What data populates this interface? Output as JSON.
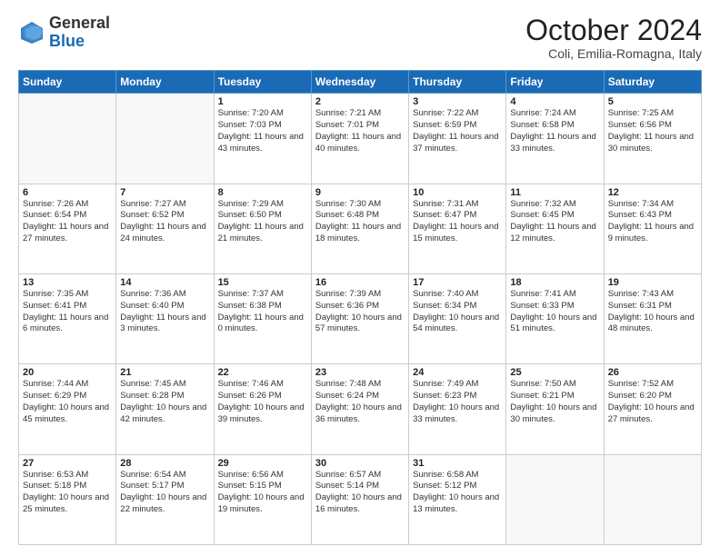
{
  "logo": {
    "general": "General",
    "blue": "Blue"
  },
  "header": {
    "month": "October 2024",
    "location": "Coli, Emilia-Romagna, Italy"
  },
  "days_of_week": [
    "Sunday",
    "Monday",
    "Tuesday",
    "Wednesday",
    "Thursday",
    "Friday",
    "Saturday"
  ],
  "weeks": [
    [
      {
        "num": "",
        "detail": ""
      },
      {
        "num": "",
        "detail": ""
      },
      {
        "num": "1",
        "detail": "Sunrise: 7:20 AM\nSunset: 7:03 PM\nDaylight: 11 hours and 43 minutes."
      },
      {
        "num": "2",
        "detail": "Sunrise: 7:21 AM\nSunset: 7:01 PM\nDaylight: 11 hours and 40 minutes."
      },
      {
        "num": "3",
        "detail": "Sunrise: 7:22 AM\nSunset: 6:59 PM\nDaylight: 11 hours and 37 minutes."
      },
      {
        "num": "4",
        "detail": "Sunrise: 7:24 AM\nSunset: 6:58 PM\nDaylight: 11 hours and 33 minutes."
      },
      {
        "num": "5",
        "detail": "Sunrise: 7:25 AM\nSunset: 6:56 PM\nDaylight: 11 hours and 30 minutes."
      }
    ],
    [
      {
        "num": "6",
        "detail": "Sunrise: 7:26 AM\nSunset: 6:54 PM\nDaylight: 11 hours and 27 minutes."
      },
      {
        "num": "7",
        "detail": "Sunrise: 7:27 AM\nSunset: 6:52 PM\nDaylight: 11 hours and 24 minutes."
      },
      {
        "num": "8",
        "detail": "Sunrise: 7:29 AM\nSunset: 6:50 PM\nDaylight: 11 hours and 21 minutes."
      },
      {
        "num": "9",
        "detail": "Sunrise: 7:30 AM\nSunset: 6:48 PM\nDaylight: 11 hours and 18 minutes."
      },
      {
        "num": "10",
        "detail": "Sunrise: 7:31 AM\nSunset: 6:47 PM\nDaylight: 11 hours and 15 minutes."
      },
      {
        "num": "11",
        "detail": "Sunrise: 7:32 AM\nSunset: 6:45 PM\nDaylight: 11 hours and 12 minutes."
      },
      {
        "num": "12",
        "detail": "Sunrise: 7:34 AM\nSunset: 6:43 PM\nDaylight: 11 hours and 9 minutes."
      }
    ],
    [
      {
        "num": "13",
        "detail": "Sunrise: 7:35 AM\nSunset: 6:41 PM\nDaylight: 11 hours and 6 minutes."
      },
      {
        "num": "14",
        "detail": "Sunrise: 7:36 AM\nSunset: 6:40 PM\nDaylight: 11 hours and 3 minutes."
      },
      {
        "num": "15",
        "detail": "Sunrise: 7:37 AM\nSunset: 6:38 PM\nDaylight: 11 hours and 0 minutes."
      },
      {
        "num": "16",
        "detail": "Sunrise: 7:39 AM\nSunset: 6:36 PM\nDaylight: 10 hours and 57 minutes."
      },
      {
        "num": "17",
        "detail": "Sunrise: 7:40 AM\nSunset: 6:34 PM\nDaylight: 10 hours and 54 minutes."
      },
      {
        "num": "18",
        "detail": "Sunrise: 7:41 AM\nSunset: 6:33 PM\nDaylight: 10 hours and 51 minutes."
      },
      {
        "num": "19",
        "detail": "Sunrise: 7:43 AM\nSunset: 6:31 PM\nDaylight: 10 hours and 48 minutes."
      }
    ],
    [
      {
        "num": "20",
        "detail": "Sunrise: 7:44 AM\nSunset: 6:29 PM\nDaylight: 10 hours and 45 minutes."
      },
      {
        "num": "21",
        "detail": "Sunrise: 7:45 AM\nSunset: 6:28 PM\nDaylight: 10 hours and 42 minutes."
      },
      {
        "num": "22",
        "detail": "Sunrise: 7:46 AM\nSunset: 6:26 PM\nDaylight: 10 hours and 39 minutes."
      },
      {
        "num": "23",
        "detail": "Sunrise: 7:48 AM\nSunset: 6:24 PM\nDaylight: 10 hours and 36 minutes."
      },
      {
        "num": "24",
        "detail": "Sunrise: 7:49 AM\nSunset: 6:23 PM\nDaylight: 10 hours and 33 minutes."
      },
      {
        "num": "25",
        "detail": "Sunrise: 7:50 AM\nSunset: 6:21 PM\nDaylight: 10 hours and 30 minutes."
      },
      {
        "num": "26",
        "detail": "Sunrise: 7:52 AM\nSunset: 6:20 PM\nDaylight: 10 hours and 27 minutes."
      }
    ],
    [
      {
        "num": "27",
        "detail": "Sunrise: 6:53 AM\nSunset: 5:18 PM\nDaylight: 10 hours and 25 minutes."
      },
      {
        "num": "28",
        "detail": "Sunrise: 6:54 AM\nSunset: 5:17 PM\nDaylight: 10 hours and 22 minutes."
      },
      {
        "num": "29",
        "detail": "Sunrise: 6:56 AM\nSunset: 5:15 PM\nDaylight: 10 hours and 19 minutes."
      },
      {
        "num": "30",
        "detail": "Sunrise: 6:57 AM\nSunset: 5:14 PM\nDaylight: 10 hours and 16 minutes."
      },
      {
        "num": "31",
        "detail": "Sunrise: 6:58 AM\nSunset: 5:12 PM\nDaylight: 10 hours and 13 minutes."
      },
      {
        "num": "",
        "detail": ""
      },
      {
        "num": "",
        "detail": ""
      }
    ]
  ]
}
